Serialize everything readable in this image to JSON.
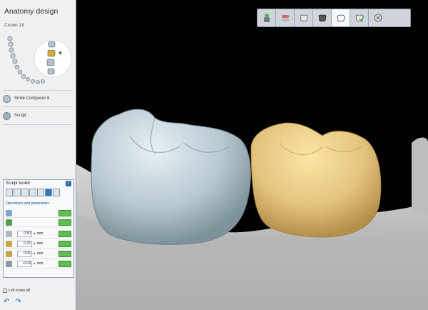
{
  "panel": {
    "title": "Anatomy design",
    "crown_label": "Crown 18",
    "smile_composer": "Smile Composer 8",
    "sculpt": "Sculpt",
    "left_crown_off": "Left crown off"
  },
  "toolkit": {
    "title": "Sculpt toolkit",
    "help": "?",
    "operations_label": "Operations and parameters",
    "unit": "mm",
    "params": [
      {
        "value": "0.50"
      },
      {
        "value": "0.25"
      },
      {
        "value": "0.05"
      },
      {
        "value": "-0.04"
      }
    ]
  },
  "toolbar": {
    "active_index": 5
  },
  "icons": [
    "tooth-setup-icon",
    "articulator-icon",
    "tooth-outline-icon",
    "dark-tooth-icon",
    "crown-icon",
    "green-tooth-icon",
    "finish-icon"
  ],
  "colors": {
    "accent": "#2f78c4",
    "go_button": "#5ebe4f",
    "crown_left": "#b9c9d2",
    "crown_right": "#e7c883"
  }
}
